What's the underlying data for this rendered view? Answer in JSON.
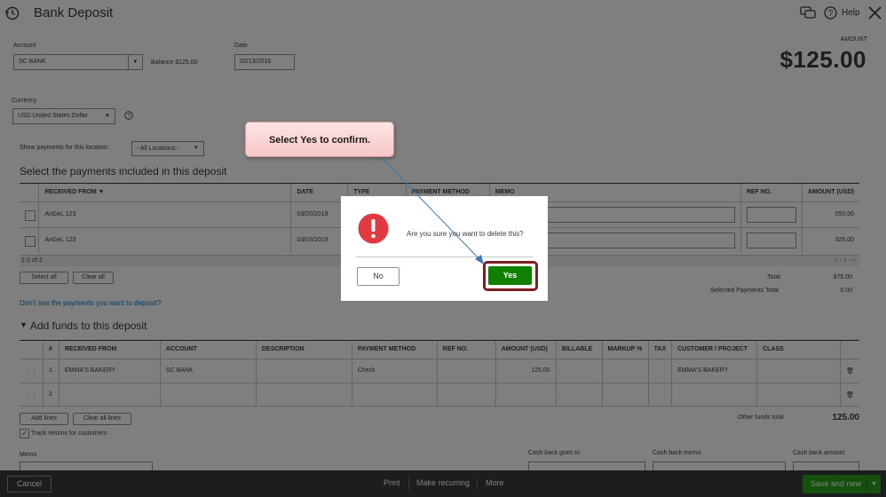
{
  "header": {
    "title": "Bank Deposit",
    "help_label": "Help"
  },
  "account": {
    "label": "Account",
    "value": "SC BANK",
    "balance_label": "Balance $125.00"
  },
  "date": {
    "label": "Date",
    "value": "02/13/2018"
  },
  "amount": {
    "label": "AMOUNT",
    "value": "$125.00"
  },
  "currency": {
    "label": "Currency",
    "value": "USD United States Dollar"
  },
  "location": {
    "label": "Show payments for this location:",
    "value": "- All Locations -"
  },
  "payments": {
    "title": "Select the payments included in this deposit",
    "columns": [
      "RECEIVED FROM ▼",
      "DATE",
      "TYPE",
      "PAYMENT METHOD",
      "MEMO",
      "REF NO.",
      "AMOUNT (USD)"
    ],
    "rows": [
      {
        "received_from": "AnGeL 123",
        "date": "03/20/2019",
        "amount": "550.00"
      },
      {
        "received_from": "AnGeL 123",
        "date": "03/03/2019",
        "amount": "325.00"
      }
    ],
    "pagination": "1-2 of 2",
    "pager_nav": "« ‹ 1 › »",
    "select_all": "Select all",
    "clear_all": "Clear all",
    "total_label": "Total",
    "total_value": "875.00",
    "selected_label": "Selected Payments Total",
    "selected_value": "0.00",
    "not_see_link": "Don't see the payments you want to deposit?"
  },
  "funds": {
    "title": "Add funds to this deposit",
    "columns": [
      "#",
      "RECEIVED FROM",
      "ACCOUNT",
      "DESCRIPTION",
      "PAYMENT METHOD",
      "REF NO.",
      "AMOUNT (USD)",
      "BILLABLE",
      "MARKUP %",
      "TAX",
      "CUSTOMER / PROJECT",
      "CLASS"
    ],
    "rows": [
      {
        "num": "1",
        "received_from": "EMMA'S BAKERY",
        "account": "SC BANK",
        "payment_method": "Check",
        "amount": "125.00",
        "customer": "EMMA'S BAKERY"
      },
      {
        "num": "2",
        "received_from": "",
        "account": "",
        "payment_method": "",
        "amount": "",
        "customer": ""
      }
    ],
    "add_lines": "Add lines",
    "clear_all_lines": "Clear all lines",
    "other_total_label": "Other funds total",
    "other_total_value": "125.00",
    "track_returns": "Track returns for customers"
  },
  "bottom": {
    "memo_label": "Memo",
    "cash_back_goes_to": "Cash back goes to",
    "cash_back_memo": "Cash back memo",
    "cash_back_amount": "Cash back amount"
  },
  "footer": {
    "cancel": "Cancel",
    "print": "Print",
    "make_recurring": "Make recurring",
    "more": "More",
    "save_new": "Save and new"
  },
  "dialog": {
    "message": "Are you sure you want to delete this?",
    "no": "No",
    "yes": "Yes"
  },
  "callout": {
    "text": "Select Yes to confirm."
  },
  "colors": {
    "accent_green": "#108000",
    "link_blue": "#0077c5",
    "alert_red": "#e2383f",
    "highlight_border": "#7b1e22"
  }
}
